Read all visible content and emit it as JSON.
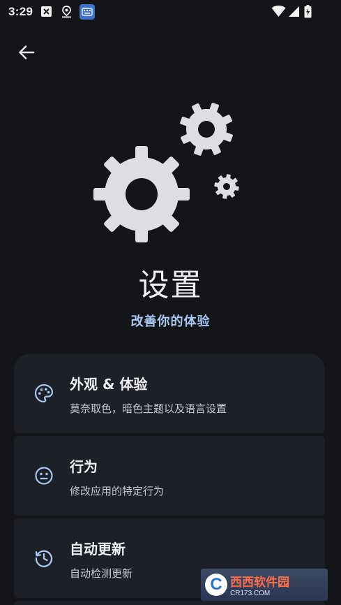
{
  "status_bar": {
    "time": "3:29",
    "icons": [
      "close-box-icon",
      "location-icon",
      "keyboard-icon",
      "wifi-icon",
      "signal-icon",
      "battery-charging-icon"
    ]
  },
  "header": {
    "back_icon": "arrow-left-icon"
  },
  "hero": {
    "illustration": "gears-icon",
    "title": "设置",
    "subtitle": "改善你的体验"
  },
  "settings": [
    {
      "icon": "palette-icon",
      "title": "外观 & 体验",
      "description": "莫奈取色，暗色主题以及语言设置"
    },
    {
      "icon": "neutral-face-icon",
      "title": "行为",
      "description": "修改应用的特定行为"
    },
    {
      "icon": "history-update-icon",
      "title": "自动更新",
      "description": "自动检测更新"
    }
  ],
  "watermark": {
    "brand": "西西软件园",
    "domain": "CR173.COM",
    "logo_letter": "C"
  },
  "colors": {
    "background": "#131519",
    "card": "#1d2026",
    "accent": "#a9c6ee",
    "gear": "#dcdee3"
  }
}
